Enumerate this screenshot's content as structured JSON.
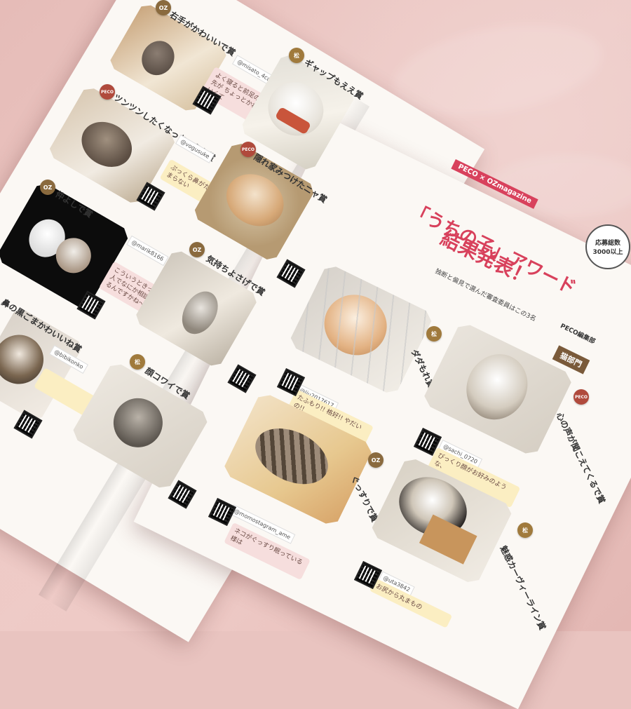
{
  "colors": {
    "blanket": "#e9c4c0",
    "paper": "#fbf8f4",
    "accent": "#d8415c",
    "tag": "#7a5a3a"
  },
  "headline": {
    "banner": "PECO × OZmagazine",
    "line1": "「うちの子」アワード",
    "line2": "結果発表！",
    "cat_section_tag": "猫部門",
    "stamp_line1": "応募総数",
    "stamp_line2": "3000以上"
  },
  "awards": [
    {
      "id": "a1",
      "badge": "OZ",
      "title": "右手がかわいいで賞",
      "handle": "@misato_4cats",
      "caption": "よく寝ると前足の先が ちょっとかわいくて"
    },
    {
      "id": "a2",
      "badge": "松",
      "title": "ギャップもええ賞",
      "handle": "@",
      "caption": ""
    },
    {
      "id": "a3",
      "badge": "PECO",
      "title": "ツンツンしたくなっちゃうね賞",
      "handle": "@vogusuke",
      "caption": "ぷっくら鼻がたまらない"
    },
    {
      "id": "a4",
      "badge": "PECO",
      "title": "隠れ家みつけたニャ賞",
      "handle": "@",
      "caption": ""
    },
    {
      "id": "a5",
      "badge": "OZ",
      "title": "仲よしで賞",
      "handle": "@marik8166",
      "caption": "こういうときって、2人でなにか相談しているんですかね〜？"
    },
    {
      "id": "a6",
      "badge": "OZ",
      "title": "気持ちよさげで賞",
      "handle": "@",
      "caption": ""
    },
    {
      "id": "a7",
      "badge": "",
      "title": "鼻の黒ごまかわいいね賞",
      "handle": "@bibikonko",
      "caption": ""
    },
    {
      "id": "a8",
      "badge": "松",
      "title": "顔コワイで賞",
      "handle": "@",
      "caption": ""
    },
    {
      "id": "a9",
      "badge": "松",
      "title": "ダダもれ賞",
      "handle": "@liu2017617",
      "caption": "たふもり!! 格好!! やだいの!!"
    },
    {
      "id": "a10",
      "badge": "PECO",
      "title": "心の声が聞こえてくるで賞",
      "handle": "@sachi_0720",
      "caption": "びっくり顔がお好みのような、"
    },
    {
      "id": "a11",
      "badge": "OZ",
      "title": "ぐっすりで賞",
      "handle": "@momostagram_ame",
      "caption": "ネコがぐっすり眠っている様は"
    },
    {
      "id": "a12",
      "badge": "松",
      "title": "魅惑カーヴィーライン賞",
      "handle": "@uta3842",
      "caption": "お尻から丸まもの"
    }
  ],
  "judges_note": "独断と偏見で選んだ審査委員はこの3名",
  "judge_label": "PECO編集部"
}
